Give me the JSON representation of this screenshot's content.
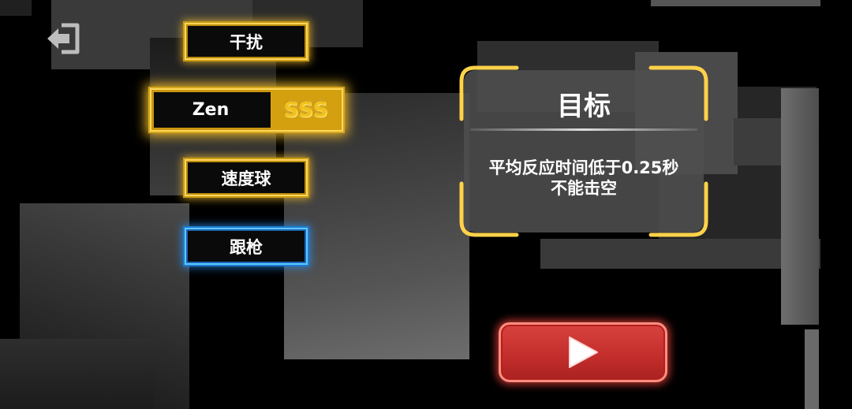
{
  "top_left": {
    "back_icon": "exit-door-arrow-icon"
  },
  "modes": [
    {
      "label": "干扰",
      "state": "gold"
    },
    {
      "label": "Zen",
      "rank": "SSS",
      "state": "gold-selected"
    },
    {
      "label": "速度球",
      "state": "gold"
    },
    {
      "label": "跟枪",
      "state": "blue"
    }
  ],
  "goal": {
    "title": "目标",
    "lines": [
      "平均反应时间低于0.25秒",
      "不能击空"
    ]
  },
  "play_button": {
    "icon": "play-triangle-icon"
  },
  "colors": {
    "gold": "#ffd75a",
    "blue": "#5ec8ff",
    "play_red": "#c22d2b"
  }
}
